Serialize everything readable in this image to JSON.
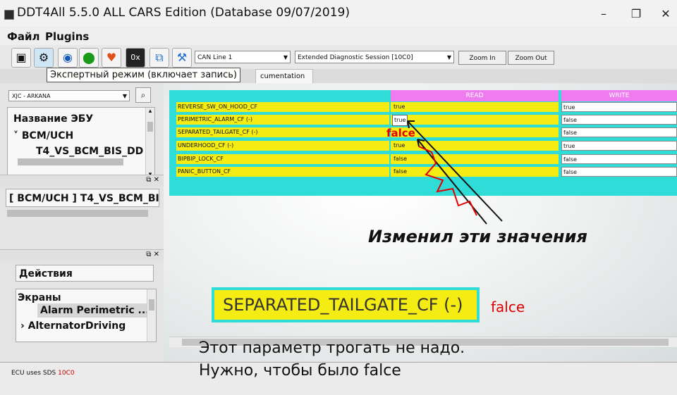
{
  "window": {
    "title": "DDT4All 5.5.0 ALL CARS Edition (Database 09/07/2019)"
  },
  "menu": {
    "items": [
      "Файл",
      "Plugins"
    ]
  },
  "toolbar": {
    "icons": [
      "scanner-icon",
      "expert-mode-icon",
      "refresh-icon",
      "connect-icon",
      "heart-icon",
      "hex-icon",
      "network-icon",
      "valve-icon"
    ],
    "hex_label": "0x",
    "can_line": "CAN Line 1",
    "session": "Extended Diagnostic Session [10C0]",
    "zoom_in": "Zoom In",
    "zoom_out": "Zoom Out"
  },
  "tooltip": "Экспертный режим (включает запись)",
  "tab": {
    "label": "cumentation"
  },
  "left": {
    "ecu_select": "XJC - ARKANA",
    "ecu_name_header": "Название ЭБУ",
    "tree": [
      "BCM/UCH",
      "T4_VS_BCM_BIS_DD"
    ],
    "ecu_label": "[ BCM/UCH ] T4_VS_BCM_BIS",
    "actions": "Действия",
    "screens_header": "Экраны",
    "screens": [
      "Alarm Perimetric ...",
      "AlternatorDriving"
    ]
  },
  "table": {
    "read_header": "READ",
    "write_header": "WRITE",
    "rows": [
      {
        "name": "REVERSE_SW_ON_HOOD_CF",
        "read": "true",
        "write": "true"
      },
      {
        "name": "PERIMETRIC_ALARM_CF (-)",
        "read": "true",
        "write": "false"
      },
      {
        "name": "SEPARATED_TAILGATE_CF (-)",
        "read": "",
        "write": "false"
      },
      {
        "name": "UNDERHOOD_CF (-)",
        "read": "true",
        "write": "true"
      },
      {
        "name": "BIPBIP_LOCK_CF",
        "read": "false",
        "write": "false"
      },
      {
        "name": "PANIC_BUTTON_CF",
        "read": "false",
        "write": "false"
      }
    ]
  },
  "annotations": {
    "handwritten_false": "falce",
    "changed_text": "Изменил эти значения",
    "zoom_param": "SEPARATED_TAILGATE_CF (-)",
    "zoom_value": "falce",
    "note_line1": "Этот параметр трогать не надо.",
    "note_line2": "Нужно, чтобы было  falce",
    "red_color": "#e10000"
  },
  "status": {
    "prefix": "ECU uses SDS",
    "code": "10C0"
  }
}
